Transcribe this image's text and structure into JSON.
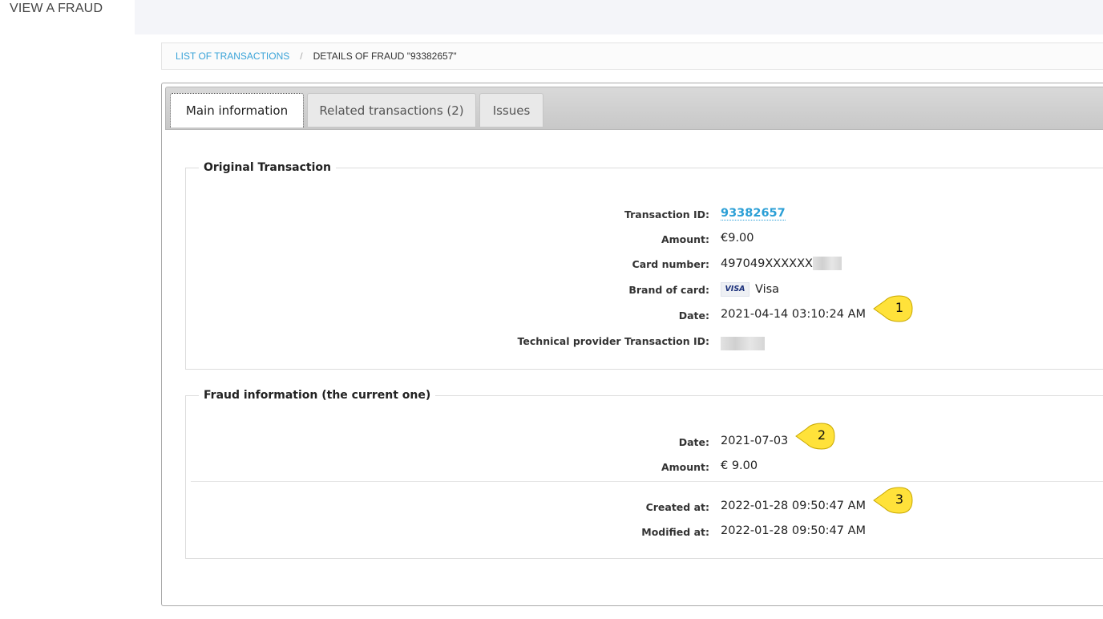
{
  "page": {
    "title": "VIEW A FRAUD"
  },
  "breadcrumb": {
    "link_label": "LIST OF TRANSACTIONS",
    "separator": "/",
    "current_label": "DETAILS OF FRAUD \"93382657\""
  },
  "tabs": [
    {
      "label": "Main information",
      "active": true
    },
    {
      "label": "Related transactions (2)",
      "active": false
    },
    {
      "label": "Issues",
      "active": false
    }
  ],
  "original_transaction": {
    "legend": "Original Transaction",
    "transaction_id": {
      "label": "Transaction ID:",
      "value": "93382657"
    },
    "amount": {
      "label": "Amount:",
      "value": "€9.00"
    },
    "card_number": {
      "label": "Card number:",
      "value": "497049XXXXXX"
    },
    "brand": {
      "label": "Brand of card:",
      "badge": "VISA",
      "value": "Visa"
    },
    "date": {
      "label": "Date:",
      "value": "2021-04-14 03:10:24 AM"
    },
    "provider_id": {
      "label": "Technical provider Transaction ID:"
    }
  },
  "fraud_information": {
    "legend": "Fraud information (the current one)",
    "date": {
      "label": "Date:",
      "value": "2021-07-03"
    },
    "amount": {
      "label": "Amount:",
      "value": "€ 9.00"
    },
    "created_at": {
      "label": "Created at:",
      "value": "2022-01-28 09:50:47 AM"
    },
    "modified_at": {
      "label": "Modified at:",
      "value": "2022-01-28 09:50:47 AM"
    }
  },
  "callouts": [
    "1",
    "2",
    "3"
  ],
  "colors": {
    "accent": "#3aa3d8",
    "callout_fill": "#ffe23a",
    "callout_stroke": "#c9a800"
  },
  "icons": {
    "card_brand": "visa-logo-icon",
    "callout": "speech-callout-icon"
  }
}
